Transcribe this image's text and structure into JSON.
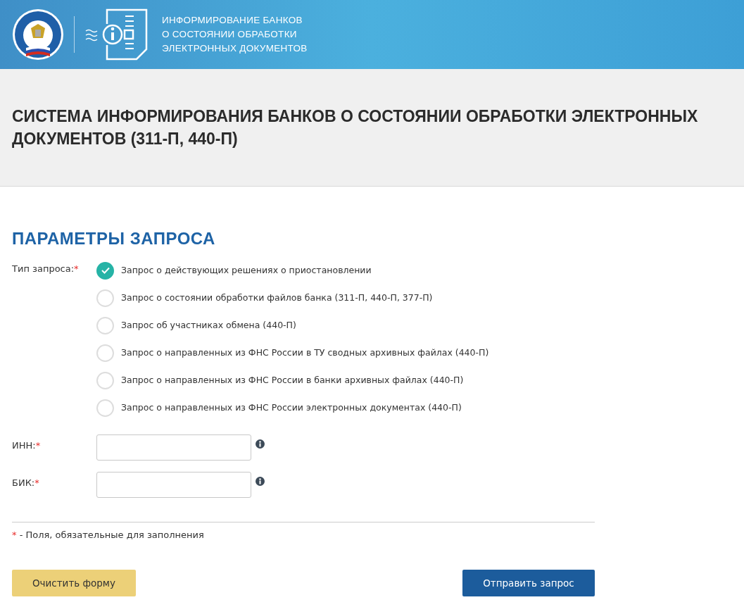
{
  "header": {
    "service_title": [
      "ИНФОРМИРОВАНИЕ БАНКОВ",
      "О СОСТОЯНИИ ОБРАБОТКИ",
      "ЭЛЕКТРОННЫХ ДОКУМЕНТОВ"
    ]
  },
  "page_title": "СИСТЕМА ИНФОРМИРОВАНИЯ БАНКОВ О СОСТОЯНИИ ОБРАБОТКИ ЭЛЕКТРОННЫХ ДОКУМЕНТОВ (311-П, 440-П)",
  "form": {
    "title": "ПАРАМЕТРЫ ЗАПРОСА",
    "request_type": {
      "label": "Тип запроса:",
      "required": true,
      "options": [
        {
          "label": "Запрос о действующих решениях о приостановлении",
          "selected": true
        },
        {
          "label": "Запрос о состоянии обработки файлов банка (311-П, 440-П, 377-П)",
          "selected": false
        },
        {
          "label": "Запрос об участниках обмена (440-П)",
          "selected": false
        },
        {
          "label": "Запрос о направленных из ФНС России в ТУ сводных архивных файлах (440-П)",
          "selected": false
        },
        {
          "label": "Запрос о направленных из ФНС России в банки архивных файлах (440-П)",
          "selected": false
        },
        {
          "label": "Запрос о направленных из ФНС России электронных документах (440-П)",
          "selected": false
        }
      ]
    },
    "fields": [
      {
        "label": "ИНН:",
        "required": true
      },
      {
        "label": "БИК:",
        "required": true
      }
    ],
    "note": {
      "mark": "*",
      "text": "- Поля, обязательные для заполнения"
    },
    "buttons": [
      {
        "label": "Очистить форму",
        "kind": "secondary"
      },
      {
        "label": "Отправить запрос",
        "kind": "primary"
      }
    ]
  }
}
